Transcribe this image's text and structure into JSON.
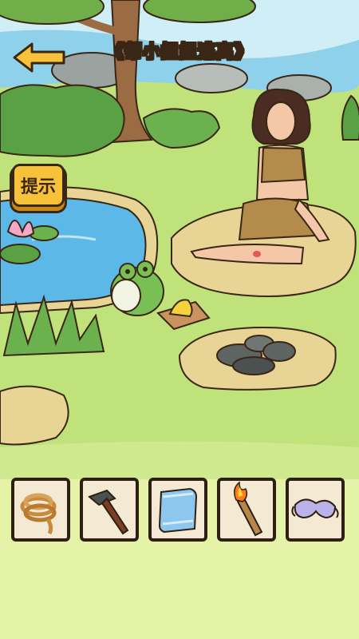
{
  "level": {
    "title": "《帮小姐姐逃离》"
  },
  "hint": {
    "label": "提示"
  },
  "inventory": {
    "items": [
      {
        "name": "rope-item",
        "icon": "rope-icon"
      },
      {
        "name": "hammer-item",
        "icon": "hammer-icon"
      },
      {
        "name": "towel-item",
        "icon": "towel-icon"
      },
      {
        "name": "torch-item",
        "icon": "torch-icon"
      },
      {
        "name": "eye-mask-item",
        "icon": "eye-mask-icon"
      }
    ]
  },
  "colors": {
    "grass": "#bfe37a",
    "water": "#5cb8e6",
    "button": "#f7c23a",
    "outline": "#3a2614"
  }
}
